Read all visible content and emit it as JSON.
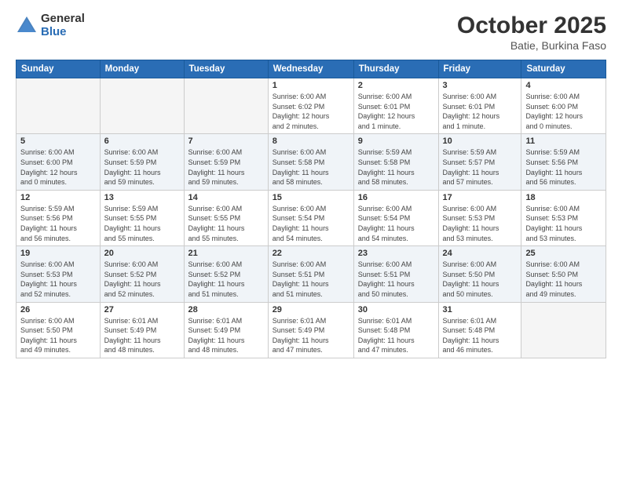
{
  "header": {
    "logo_general": "General",
    "logo_blue": "Blue",
    "month_title": "October 2025",
    "subtitle": "Batie, Burkina Faso"
  },
  "weekdays": [
    "Sunday",
    "Monday",
    "Tuesday",
    "Wednesday",
    "Thursday",
    "Friday",
    "Saturday"
  ],
  "weeks": [
    [
      {
        "day": "",
        "info": ""
      },
      {
        "day": "",
        "info": ""
      },
      {
        "day": "",
        "info": ""
      },
      {
        "day": "1",
        "info": "Sunrise: 6:00 AM\nSunset: 6:02 PM\nDaylight: 12 hours\nand 2 minutes."
      },
      {
        "day": "2",
        "info": "Sunrise: 6:00 AM\nSunset: 6:01 PM\nDaylight: 12 hours\nand 1 minute."
      },
      {
        "day": "3",
        "info": "Sunrise: 6:00 AM\nSunset: 6:01 PM\nDaylight: 12 hours\nand 1 minute."
      },
      {
        "day": "4",
        "info": "Sunrise: 6:00 AM\nSunset: 6:00 PM\nDaylight: 12 hours\nand 0 minutes."
      }
    ],
    [
      {
        "day": "5",
        "info": "Sunrise: 6:00 AM\nSunset: 6:00 PM\nDaylight: 12 hours\nand 0 minutes."
      },
      {
        "day": "6",
        "info": "Sunrise: 6:00 AM\nSunset: 5:59 PM\nDaylight: 11 hours\nand 59 minutes."
      },
      {
        "day": "7",
        "info": "Sunrise: 6:00 AM\nSunset: 5:59 PM\nDaylight: 11 hours\nand 59 minutes."
      },
      {
        "day": "8",
        "info": "Sunrise: 6:00 AM\nSunset: 5:58 PM\nDaylight: 11 hours\nand 58 minutes."
      },
      {
        "day": "9",
        "info": "Sunrise: 5:59 AM\nSunset: 5:58 PM\nDaylight: 11 hours\nand 58 minutes."
      },
      {
        "day": "10",
        "info": "Sunrise: 5:59 AM\nSunset: 5:57 PM\nDaylight: 11 hours\nand 57 minutes."
      },
      {
        "day": "11",
        "info": "Sunrise: 5:59 AM\nSunset: 5:56 PM\nDaylight: 11 hours\nand 56 minutes."
      }
    ],
    [
      {
        "day": "12",
        "info": "Sunrise: 5:59 AM\nSunset: 5:56 PM\nDaylight: 11 hours\nand 56 minutes."
      },
      {
        "day": "13",
        "info": "Sunrise: 5:59 AM\nSunset: 5:55 PM\nDaylight: 11 hours\nand 55 minutes."
      },
      {
        "day": "14",
        "info": "Sunrise: 6:00 AM\nSunset: 5:55 PM\nDaylight: 11 hours\nand 55 minutes."
      },
      {
        "day": "15",
        "info": "Sunrise: 6:00 AM\nSunset: 5:54 PM\nDaylight: 11 hours\nand 54 minutes."
      },
      {
        "day": "16",
        "info": "Sunrise: 6:00 AM\nSunset: 5:54 PM\nDaylight: 11 hours\nand 54 minutes."
      },
      {
        "day": "17",
        "info": "Sunrise: 6:00 AM\nSunset: 5:53 PM\nDaylight: 11 hours\nand 53 minutes."
      },
      {
        "day": "18",
        "info": "Sunrise: 6:00 AM\nSunset: 5:53 PM\nDaylight: 11 hours\nand 53 minutes."
      }
    ],
    [
      {
        "day": "19",
        "info": "Sunrise: 6:00 AM\nSunset: 5:53 PM\nDaylight: 11 hours\nand 52 minutes."
      },
      {
        "day": "20",
        "info": "Sunrise: 6:00 AM\nSunset: 5:52 PM\nDaylight: 11 hours\nand 52 minutes."
      },
      {
        "day": "21",
        "info": "Sunrise: 6:00 AM\nSunset: 5:52 PM\nDaylight: 11 hours\nand 51 minutes."
      },
      {
        "day": "22",
        "info": "Sunrise: 6:00 AM\nSunset: 5:51 PM\nDaylight: 11 hours\nand 51 minutes."
      },
      {
        "day": "23",
        "info": "Sunrise: 6:00 AM\nSunset: 5:51 PM\nDaylight: 11 hours\nand 50 minutes."
      },
      {
        "day": "24",
        "info": "Sunrise: 6:00 AM\nSunset: 5:50 PM\nDaylight: 11 hours\nand 50 minutes."
      },
      {
        "day": "25",
        "info": "Sunrise: 6:00 AM\nSunset: 5:50 PM\nDaylight: 11 hours\nand 49 minutes."
      }
    ],
    [
      {
        "day": "26",
        "info": "Sunrise: 6:00 AM\nSunset: 5:50 PM\nDaylight: 11 hours\nand 49 minutes."
      },
      {
        "day": "27",
        "info": "Sunrise: 6:01 AM\nSunset: 5:49 PM\nDaylight: 11 hours\nand 48 minutes."
      },
      {
        "day": "28",
        "info": "Sunrise: 6:01 AM\nSunset: 5:49 PM\nDaylight: 11 hours\nand 48 minutes."
      },
      {
        "day": "29",
        "info": "Sunrise: 6:01 AM\nSunset: 5:49 PM\nDaylight: 11 hours\nand 47 minutes."
      },
      {
        "day": "30",
        "info": "Sunrise: 6:01 AM\nSunset: 5:48 PM\nDaylight: 11 hours\nand 47 minutes."
      },
      {
        "day": "31",
        "info": "Sunrise: 6:01 AM\nSunset: 5:48 PM\nDaylight: 11 hours\nand 46 minutes."
      },
      {
        "day": "",
        "info": ""
      }
    ]
  ]
}
